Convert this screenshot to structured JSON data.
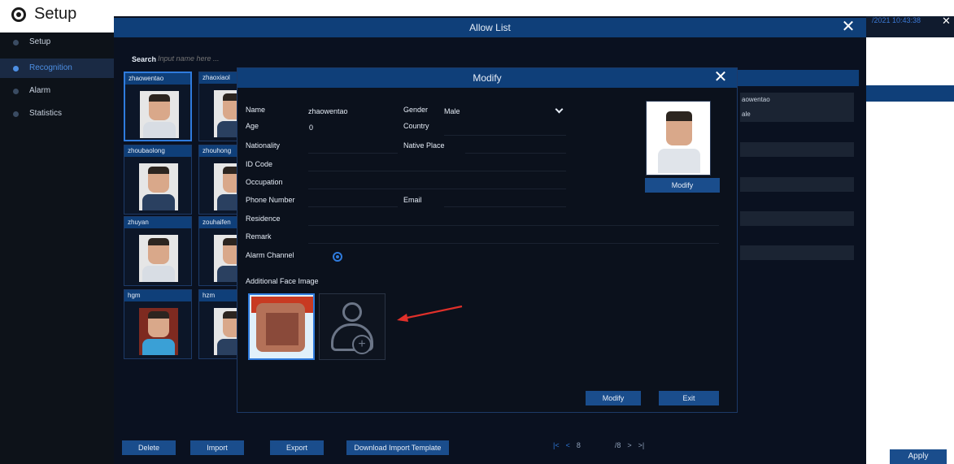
{
  "app": {
    "title": "Setup"
  },
  "sidebar": {
    "items": [
      {
        "label": "Setup",
        "active": false
      },
      {
        "label": "Recognition",
        "active": true
      },
      {
        "label": "Alarm",
        "active": false
      },
      {
        "label": "Statistics",
        "active": false
      }
    ]
  },
  "allow_list": {
    "title": "Allow List",
    "search_label": "Search",
    "search_placeholder": "Input name here ...",
    "entries": [
      {
        "name": "zhaowentao"
      },
      {
        "name": "zhaoxiaol"
      },
      {
        "name": "zhoubaolong"
      },
      {
        "name": "zhouhong"
      },
      {
        "name": "zhuyan"
      },
      {
        "name": "zouhaifen"
      },
      {
        "name": "hgm"
      },
      {
        "name": "hzm"
      }
    ],
    "right_panel": {
      "name_value": "aowentao",
      "gender_value": "ale"
    },
    "buttons": {
      "delete": "Delete",
      "import": "Import",
      "export": "Export",
      "download_template": "Download Import Template"
    },
    "pager": {
      "first": "|<",
      "prev": "<",
      "current": "8",
      "total": "/8",
      "next": ">",
      "last": ">|"
    }
  },
  "datetime_fragment": "/2021 10:43:38",
  "apply_label": "Apply",
  "modify_dialog": {
    "title": "Modify",
    "fields": {
      "name_label": "Name",
      "name_value": "zhaowentao",
      "gender_label": "Gender",
      "gender_value": "Male",
      "age_label": "Age",
      "age_value": "0",
      "country_label": "Country",
      "nationality_label": "Nationality",
      "native_place_label": "Native Place",
      "id_code_label": "ID Code",
      "occupation_label": "Occupation",
      "phone_label": "Phone Number",
      "email_label": "Email",
      "residence_label": "Residence",
      "remark_label": "Remark",
      "alarm_channel_label": "Alarm Channel",
      "additional_face_label": "Additional Face Image"
    },
    "portrait_button": "Modify",
    "modify_button": "Modify",
    "exit_button": "Exit"
  },
  "colors": {
    "accent": "#2f7bdd",
    "title_bar": "#0f3f79",
    "background": "#0a1120",
    "arrow": "#e0302a"
  }
}
